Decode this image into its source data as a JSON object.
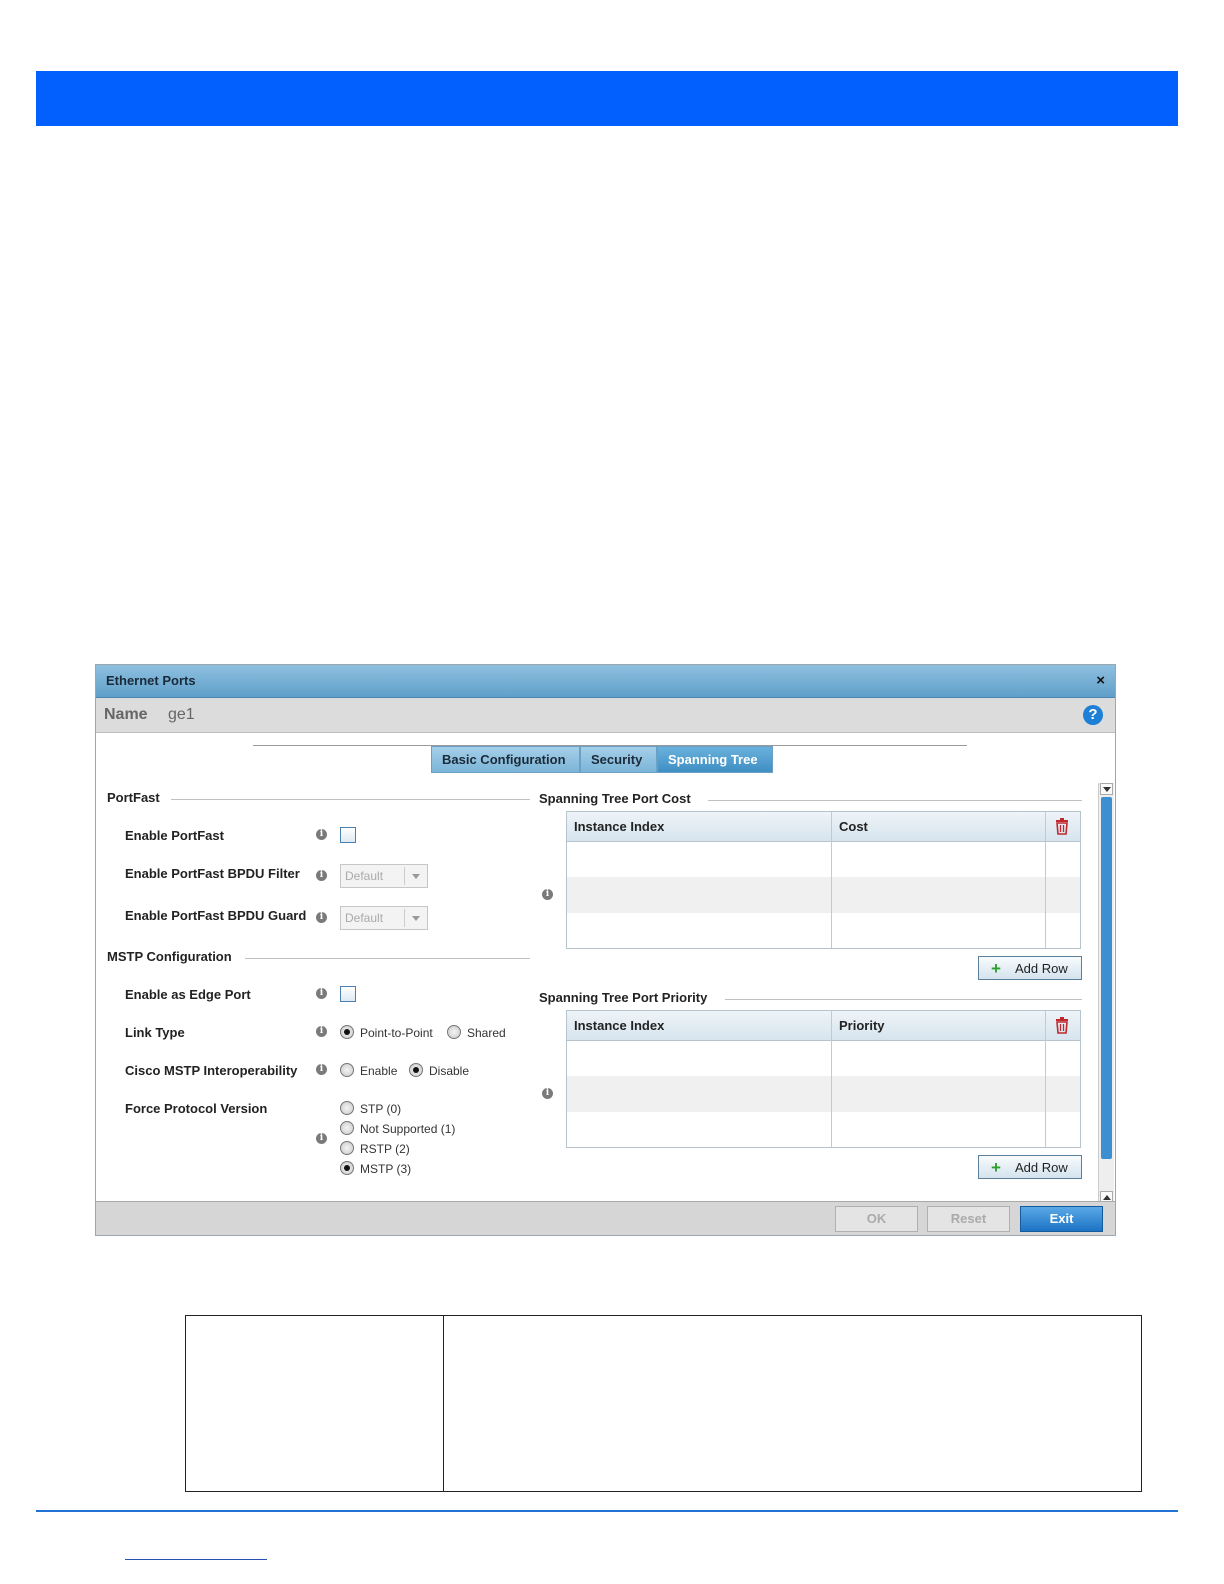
{
  "dialog": {
    "title": "Ethernet Ports",
    "close_glyph": "×",
    "name_label": "Name",
    "name_value": "ge1",
    "help_glyph": "?"
  },
  "tabs": [
    {
      "label": "Basic Configuration",
      "active": false
    },
    {
      "label": "Security",
      "active": false
    },
    {
      "label": "Spanning Tree",
      "active": true
    }
  ],
  "portfast": {
    "section_title": "PortFast",
    "enable_portfast_label": "Enable PortFast",
    "bpdu_filter_label": "Enable PortFast BPDU Filter",
    "bpdu_filter_value": "Default",
    "bpdu_guard_label": "Enable PortFast BPDU Guard",
    "bpdu_guard_value": "Default"
  },
  "mstp": {
    "section_title": "MSTP Configuration",
    "edge_port_label": "Enable as Edge Port",
    "link_type_label": "Link Type",
    "link_type_options": [
      "Point-to-Point",
      "Shared"
    ],
    "link_type_selected": "Point-to-Point",
    "cisco_label": "Cisco MSTP Interoperability",
    "cisco_options": [
      "Enable",
      "Disable"
    ],
    "cisco_selected": "Disable",
    "force_label": "Force Protocol Version",
    "force_options": [
      "STP (0)",
      "Not Supported (1)",
      "RSTP (2)",
      "MSTP (3)"
    ],
    "force_selected": "MSTP (3)"
  },
  "port_cost": {
    "section_title": "Spanning Tree Port Cost",
    "col1": "Instance Index",
    "col2": "Cost",
    "add_row": "Add Row"
  },
  "port_priority": {
    "section_title": "Spanning Tree Port Priority",
    "col1": "Instance Index",
    "col2": "Priority",
    "add_row": "Add Row"
  },
  "footer": {
    "ok": "OK",
    "reset": "Reset",
    "exit": "Exit"
  },
  "colors": {
    "header_band": "#0160fe",
    "tab_active": "#3f8fc4",
    "exit_button": "#1c73c4"
  },
  "icons": {
    "info": "info-icon",
    "trash": "trash-icon",
    "help": "help-icon",
    "close": "close-icon",
    "add": "plus-icon"
  }
}
